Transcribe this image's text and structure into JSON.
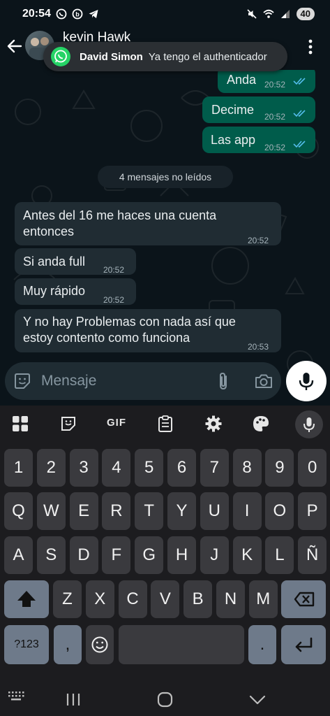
{
  "status_bar": {
    "time": "20:54",
    "battery": "40"
  },
  "header": {
    "contact_name": "kevin Hawk"
  },
  "notification_toast": {
    "sender": "David Simon",
    "text": "Ya tengo el authenticador"
  },
  "messages_out": [
    {
      "text": "Anda",
      "time": "20:52"
    },
    {
      "text": "Decime",
      "time": "20:52"
    },
    {
      "text": "Las app",
      "time": "20:52"
    }
  ],
  "unread_divider": "4 mensajes no leídos",
  "messages_in": [
    {
      "line1": "Antes del 16 me haces una cuenta",
      "line2": "entonces",
      "time": "20:52"
    },
    {
      "line1": "Si anda full",
      "line2": "",
      "time": "20:52"
    },
    {
      "line1": "Muy rápido",
      "line2": "",
      "time": "20:52"
    },
    {
      "line1": "Y no hay Problemas con nada así que",
      "line2": "estoy contento como funciona",
      "time": "20:53"
    }
  ],
  "composer": {
    "placeholder": "Mensaje"
  },
  "keyboard": {
    "toolbar_gif": "GIF",
    "row_numbers": [
      "1",
      "2",
      "3",
      "4",
      "5",
      "6",
      "7",
      "8",
      "9",
      "0"
    ],
    "row_q": [
      "Q",
      "W",
      "E",
      "R",
      "T",
      "Y",
      "U",
      "I",
      "O",
      "P"
    ],
    "row_a": [
      "A",
      "S",
      "D",
      "F",
      "G",
      "H",
      "J",
      "K",
      "L",
      "Ñ"
    ],
    "row_z": [
      "Z",
      "X",
      "C",
      "V",
      "B",
      "N",
      "M"
    ],
    "symbols_key": "?123",
    "comma_key": ",",
    "period_key": "."
  },
  "colors": {
    "outgoing_bubble": "#005c4b",
    "incoming_bubble": "#202c33",
    "background": "#0b141a",
    "read_ticks": "#53bdeb"
  }
}
